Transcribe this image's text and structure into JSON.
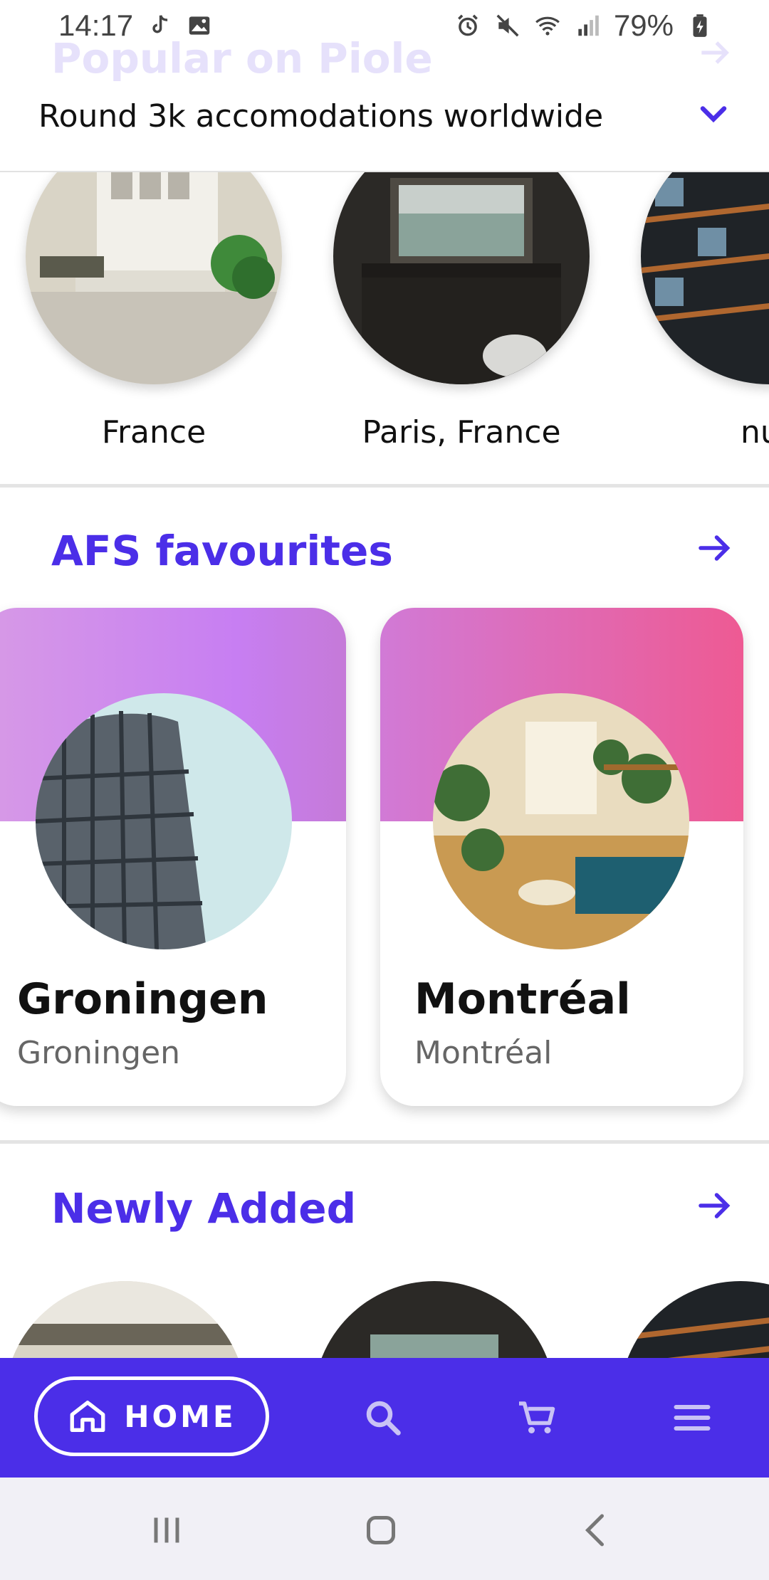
{
  "status_bar": {
    "time": "14:17",
    "battery": "79%",
    "left_icons": [
      "tiktok-icon",
      "gallery-icon"
    ],
    "right_icons": [
      "alarm-icon",
      "mute-icon",
      "wifi-icon",
      "signal-icon",
      "battery-icon"
    ]
  },
  "ghost_section": {
    "title": "Popular on Piole"
  },
  "header": {
    "title": "Round 3k accomodations worldwide"
  },
  "popular": {
    "items": [
      {
        "label": "France"
      },
      {
        "label": "Paris, France"
      },
      {
        "label": "nu"
      }
    ]
  },
  "afs": {
    "title": "AFS favourites",
    "cards": [
      {
        "name": "Groningen",
        "sub": "Groningen"
      },
      {
        "name": "Montréal",
        "sub": "Montréal"
      }
    ]
  },
  "newly": {
    "title": "Newly Added"
  },
  "nav": {
    "home_label": "HOME",
    "icons": [
      "home-icon",
      "search-icon",
      "cart-icon",
      "menu-icon"
    ]
  },
  "colors": {
    "accent": "#4b2ee8",
    "grad_card1_start": "#d79ae6",
    "grad_card1_end": "#c77ef2",
    "grad_card2_start": "#d17ad6",
    "grad_card2_end": "#ee5a93"
  }
}
